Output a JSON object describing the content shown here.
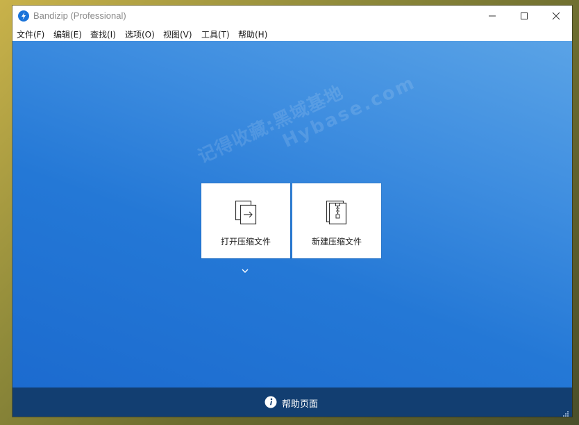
{
  "window": {
    "title": "Bandizip (Professional)"
  },
  "menu": {
    "items": [
      {
        "label": "文件(F)"
      },
      {
        "label": "编辑(E)"
      },
      {
        "label": "查找(I)"
      },
      {
        "label": "选项(O)"
      },
      {
        "label": "视图(V)"
      },
      {
        "label": "工具(T)"
      },
      {
        "label": "帮助(H)"
      }
    ]
  },
  "main": {
    "open_archive_label": "打开压缩文件",
    "new_archive_label": "新建压缩文件"
  },
  "watermark": {
    "line1": "记得收藏:黑域基地",
    "line2": "Hybase.com"
  },
  "footer": {
    "help_label": "帮助页面"
  },
  "icons": {
    "app": "bandizip-logo-icon",
    "open": "open-archive-icon",
    "new": "zip-archive-icon",
    "help": "info-icon",
    "expand": "chevron-down-icon"
  },
  "colors": {
    "accent": "#1a73d9",
    "content_top": "#5aa3e6",
    "content_bottom": "#1c6bcf",
    "footer_bg": "#123e71"
  }
}
